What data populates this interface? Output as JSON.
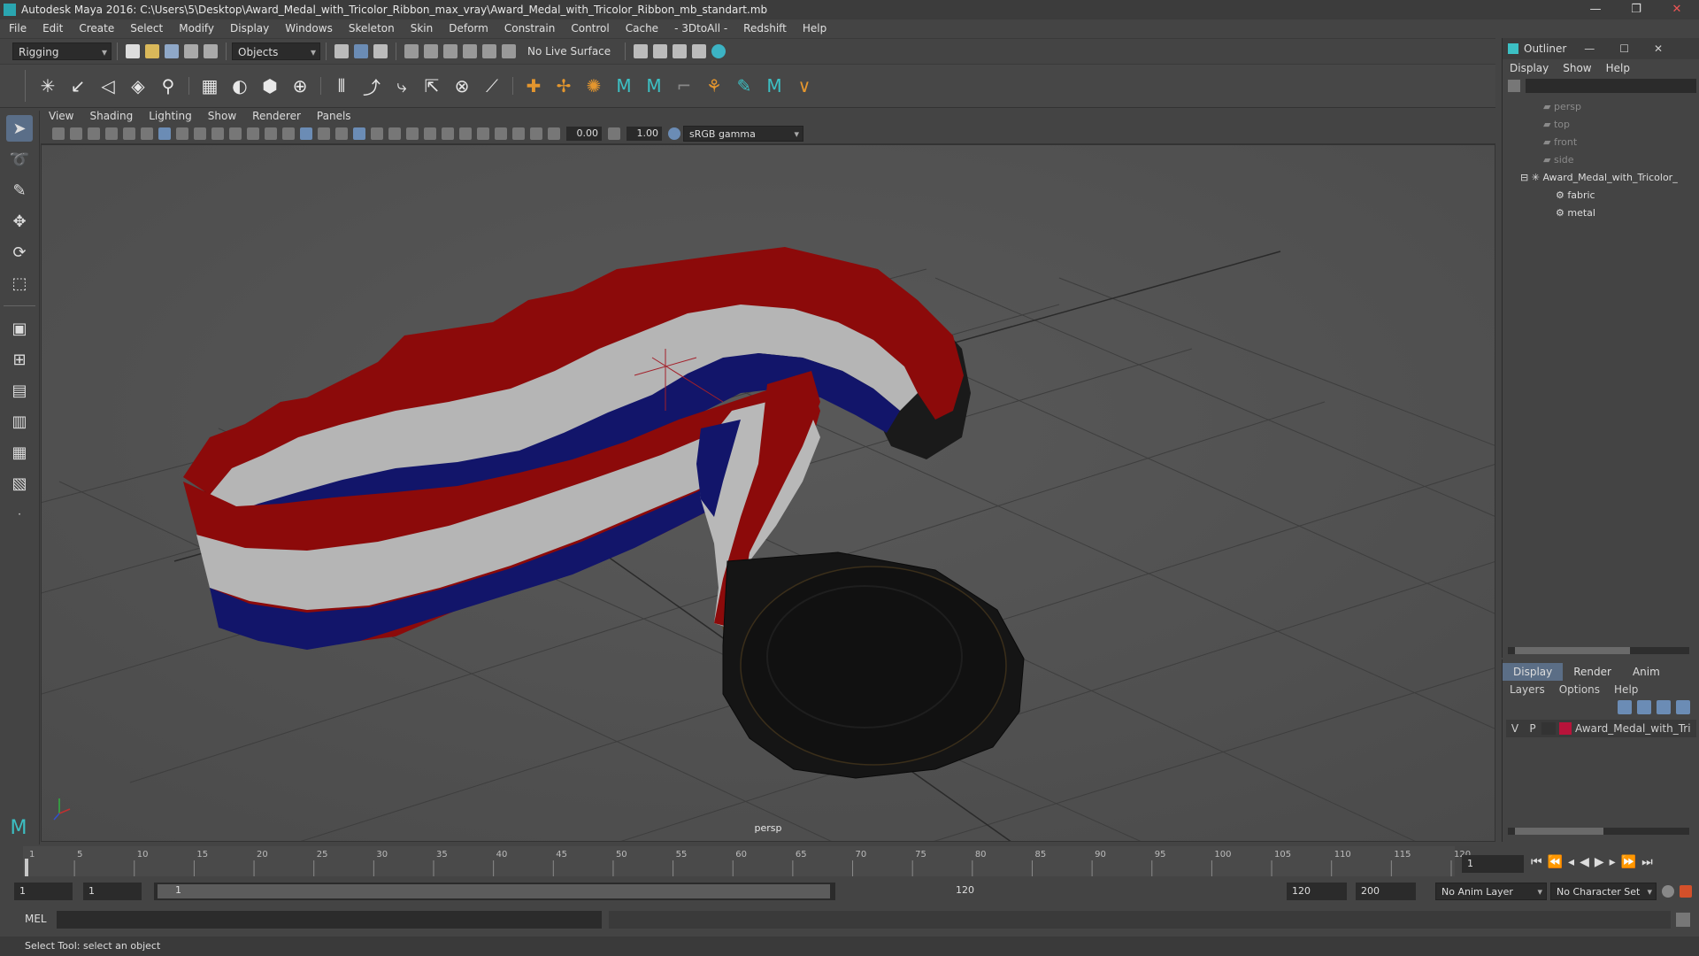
{
  "window": {
    "title": "Autodesk Maya 2016: C:\\Users\\5\\Desktop\\Award_Medal_with_Tricolor_Ribbon_max_vray\\Award_Medal_with_Tricolor_Ribbon_mb_standart.mb"
  },
  "menubar": [
    "File",
    "Edit",
    "Create",
    "Select",
    "Modify",
    "Display",
    "Windows",
    "Skeleton",
    "Skin",
    "Deform",
    "Constrain",
    "Control",
    "Cache",
    "- 3DtoAll -",
    "Redshift",
    "Help"
  ],
  "statusline": {
    "mode": "Rigging",
    "objects": "Objects",
    "live_surface": "No Live Surface"
  },
  "viewport": {
    "menu": [
      "View",
      "Shading",
      "Lighting",
      "Show",
      "Renderer",
      "Panels"
    ],
    "exposure": "0.00",
    "gamma": "1.00",
    "color_space": "sRGB gamma",
    "camera": "persp"
  },
  "outliner": {
    "title": "Outliner",
    "menu": [
      "Display",
      "Show",
      "Help"
    ],
    "cameras": [
      "persp",
      "top",
      "front",
      "side"
    ],
    "root": "Award_Medal_with_Tricolor_",
    "children": [
      "fabric",
      "metal"
    ]
  },
  "layers": {
    "tabs": [
      "Display",
      "Render",
      "Anim"
    ],
    "menu": [
      "Layers",
      "Options",
      "Help"
    ],
    "layer": {
      "v": "V",
      "p": "P",
      "name": "Award_Medal_with_Tri",
      "color": "#b8133a"
    }
  },
  "timeline": {
    "ticks": [
      "1",
      "5",
      "10",
      "15",
      "20",
      "25",
      "30",
      "35",
      "40",
      "45",
      "50",
      "55",
      "60",
      "65",
      "70",
      "75",
      "80",
      "85",
      "90",
      "95",
      "100",
      "105",
      "110",
      "115",
      "120"
    ],
    "current_frame": "1"
  },
  "range": {
    "start": "1",
    "start2": "1",
    "slider_start": "1",
    "slider_end": "120",
    "end": "120",
    "end2": "200",
    "anim_layer": "No Anim Layer",
    "char_set": "No Character Set"
  },
  "cmdline": {
    "label": "MEL"
  },
  "helpline": {
    "text": "Select Tool: select an object"
  },
  "colors": {
    "ribbon_red": "#7a0a0a",
    "ribbon_white": "#b8b8b8",
    "ribbon_blue": "#10125e",
    "medal": "#141414",
    "accent": "#5b6e86"
  }
}
